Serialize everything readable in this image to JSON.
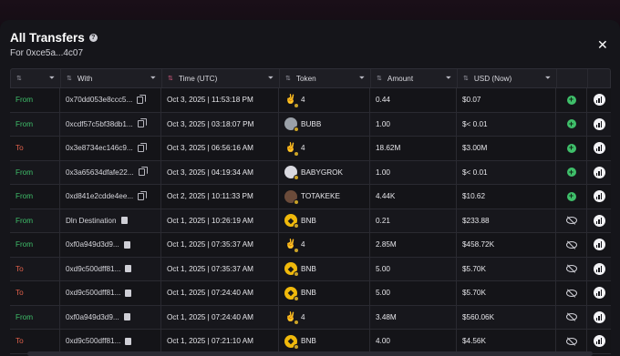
{
  "modal": {
    "title": "All Transfers",
    "help_icon": "question-icon",
    "subtitle": "For 0xce5a...4c07",
    "close_icon": "close-icon"
  },
  "columns": [
    {
      "label": "",
      "filter_icon": "filter-icon"
    },
    {
      "label": "With",
      "filter_icon": "filter-icon"
    },
    {
      "label": "Time (UTC)",
      "filter_icon": "filter-icon"
    },
    {
      "label": "Token",
      "filter_icon": "filter-icon"
    },
    {
      "label": "Amount",
      "filter_icon": "filter-icon"
    },
    {
      "label": "USD (Now)",
      "filter_icon": "filter-icon"
    }
  ],
  "rows": [
    {
      "direction": "From",
      "with": "0x70dd053e8ccc5...",
      "with_icon": "copy-icon",
      "time": "Oct 3, 2025 | 11:53:18 PM",
      "token_icon": "hand-icon",
      "token": "4",
      "amount": "0.44",
      "usd": "$0.07",
      "action": "plus-icon"
    },
    {
      "direction": "From",
      "with": "0xcdf57c5bf38db1...",
      "with_icon": "copy-icon",
      "time": "Oct 3, 2025 | 03:18:07 PM",
      "token_icon": "bubb-icon",
      "token": "BUBB",
      "amount": "1.00",
      "usd": "$< 0.01",
      "action": "plus-icon"
    },
    {
      "direction": "To",
      "with": "0x3e8734ec146c9...",
      "with_icon": "copy-icon",
      "time": "Oct 3, 2025 | 06:56:16 AM",
      "token_icon": "hand-icon",
      "token": "4",
      "amount": "18.62M",
      "usd": "$3.00M",
      "action": "plus-icon"
    },
    {
      "direction": "From",
      "with": "0x3a65634dfafe22...",
      "with_icon": "copy-icon",
      "time": "Oct 3, 2025 | 04:19:34 AM",
      "token_icon": "babygrok-icon",
      "token": "BABYGROK",
      "amount": "1.00",
      "usd": "$< 0.01",
      "action": "plus-icon"
    },
    {
      "direction": "From",
      "with": "0xd841e2cdde4ee...",
      "with_icon": "copy-icon",
      "time": "Oct 2, 2025 | 10:11:33 PM",
      "token_icon": "totakeke-icon",
      "token": "TOTAKEKE",
      "amount": "4.44K",
      "usd": "$10.62",
      "action": "plus-icon"
    },
    {
      "direction": "From",
      "with": "Dln Destination",
      "with_icon": "doc-icon",
      "time": "Oct 1, 2025 | 10:26:19 AM",
      "token_icon": "bnb-icon",
      "token": "BNB",
      "amount": "0.21",
      "usd": "$233.88",
      "action": "eye-off-icon"
    },
    {
      "direction": "From",
      "with": "0xf0a949d3d9...",
      "with_icon": "doc-icon",
      "time": "Oct 1, 2025 | 07:35:37 AM",
      "token_icon": "hand-icon",
      "token": "4",
      "amount": "2.85M",
      "usd": "$458.72K",
      "action": "eye-off-icon"
    },
    {
      "direction": "To",
      "with": "0xd9c500dff81...",
      "with_icon": "doc-icon",
      "time": "Oct 1, 2025 | 07:35:37 AM",
      "token_icon": "bnb-icon",
      "token": "BNB",
      "amount": "5.00",
      "usd": "$5.70K",
      "action": "eye-off-icon"
    },
    {
      "direction": "To",
      "with": "0xd9c500dff81...",
      "with_icon": "doc-icon",
      "time": "Oct 1, 2025 | 07:24:40 AM",
      "token_icon": "bnb-icon",
      "token": "BNB",
      "amount": "5.00",
      "usd": "$5.70K",
      "action": "eye-off-icon"
    },
    {
      "direction": "From",
      "with": "0xf0a949d3d9...",
      "with_icon": "doc-icon",
      "time": "Oct 1, 2025 | 07:24:40 AM",
      "token_icon": "hand-icon",
      "token": "4",
      "amount": "3.48M",
      "usd": "$560.06K",
      "action": "eye-off-icon"
    },
    {
      "direction": "To",
      "with": "0xd9c500dff81...",
      "with_icon": "doc-icon",
      "time": "Oct 1, 2025 | 07:21:10 AM",
      "token_icon": "bnb-icon",
      "token": "BNB",
      "amount": "4.00",
      "usd": "$4.56K",
      "action": "eye-off-icon"
    }
  ],
  "colors": {
    "from": "#3fbf6a",
    "to": "#e0604a",
    "sort_active": "#d15a7e"
  }
}
